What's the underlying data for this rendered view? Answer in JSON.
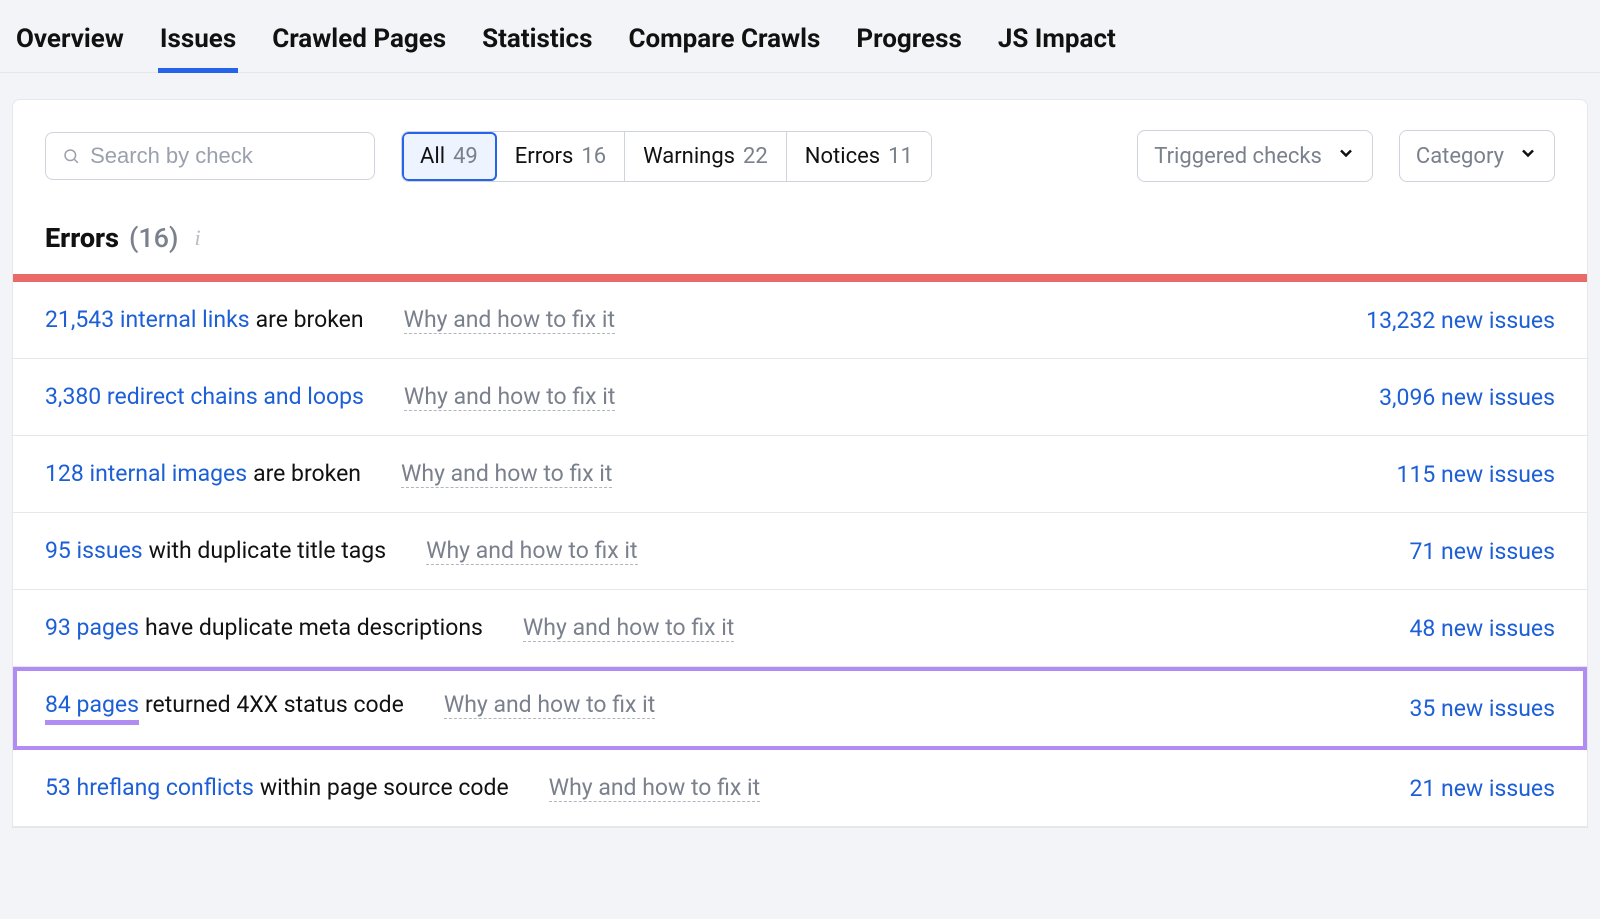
{
  "tabs": [
    {
      "label": "Overview"
    },
    {
      "label": "Issues",
      "active": true
    },
    {
      "label": "Crawled Pages"
    },
    {
      "label": "Statistics"
    },
    {
      "label": "Compare Crawls"
    },
    {
      "label": "Progress"
    },
    {
      "label": "JS Impact"
    }
  ],
  "search": {
    "placeholder": "Search by check"
  },
  "filters": {
    "all": {
      "label": "All",
      "count": "49",
      "active": true
    },
    "errors": {
      "label": "Errors",
      "count": "16"
    },
    "warnings": {
      "label": "Warnings",
      "count": "22"
    },
    "notices": {
      "label": "Notices",
      "count": "11"
    }
  },
  "dropdowns": {
    "triggered": "Triggered checks",
    "category": "Category"
  },
  "section": {
    "title": "Errors",
    "count": "(16)"
  },
  "fix_label": "Why and how to fix it",
  "rows": [
    {
      "link": "21,543 internal links",
      "rest": " are broken",
      "new": "13,232 new issues"
    },
    {
      "link": "3,380 redirect chains and loops",
      "rest": "",
      "new": "3,096 new issues"
    },
    {
      "link": "128 internal images",
      "rest": " are broken",
      "new": "115 new issues"
    },
    {
      "link": "95 issues",
      "rest": " with duplicate title tags",
      "new": "71 new issues"
    },
    {
      "link": "93 pages",
      "rest": " have duplicate meta descriptions",
      "new": "48 new issues"
    },
    {
      "link": "84 pages",
      "rest": " returned 4XX status code",
      "new": "35 new issues",
      "highlight": true
    },
    {
      "link": "53 hreflang conflicts",
      "rest": " within page source code",
      "new": "21 new issues"
    }
  ]
}
